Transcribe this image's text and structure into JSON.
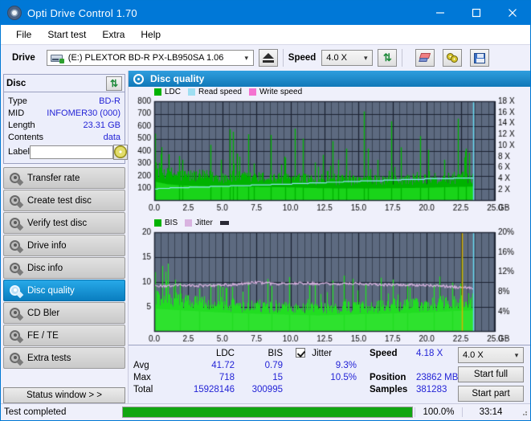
{
  "window": {
    "title": "Opti Drive Control 1.70",
    "minimize": "–",
    "maximize": "☐",
    "close": "✕"
  },
  "menu": [
    "File",
    "Start test",
    "Extra",
    "Help"
  ],
  "toolbar": {
    "drive_label": "Drive",
    "drive_value": "(E:)   PLEXTOR BD-R  PX-LB950SA 1.06",
    "speed_label": "Speed",
    "speed_value": "4.0 X"
  },
  "disc": {
    "title": "Disc",
    "rows": [
      {
        "key": "Type",
        "value": "BD-R"
      },
      {
        "key": "MID",
        "value": "INFOMER30 (000)"
      },
      {
        "key": "Length",
        "value": "23.31 GB"
      },
      {
        "key": "Contents",
        "value": "data"
      }
    ],
    "label_key": "Label",
    "label_value": ""
  },
  "nav": {
    "items": [
      {
        "label": "Transfer rate",
        "selected": false
      },
      {
        "label": "Create test disc",
        "selected": false
      },
      {
        "label": "Verify test disc",
        "selected": false
      },
      {
        "label": "Drive info",
        "selected": false
      },
      {
        "label": "Disc info",
        "selected": false
      },
      {
        "label": "Disc quality",
        "selected": true
      },
      {
        "label": "CD Bler",
        "selected": false
      },
      {
        "label": "FE / TE",
        "selected": false
      },
      {
        "label": "Extra tests",
        "selected": false
      }
    ],
    "status_window": "Status window > >"
  },
  "panel": {
    "title": "Disc quality"
  },
  "stats": {
    "col_ldc": "LDC",
    "col_bis": "BIS",
    "jitter_label": "Jitter",
    "jitter_checked": true,
    "rows": [
      {
        "name": "Avg",
        "ldc": "41.72",
        "bis": "0.79",
        "jitter": "9.3%"
      },
      {
        "name": "Max",
        "ldc": "718",
        "bis": "15",
        "jitter": "10.5%"
      },
      {
        "name": "Total",
        "ldc": "15928146",
        "bis": "300995",
        "jitter": ""
      }
    ],
    "speed_label": "Speed",
    "speed_value": "4.18 X",
    "position_label": "Position",
    "position_value": "23862 MB",
    "samples_label": "Samples",
    "samples_value": "381283",
    "speed_select": "4.0 X",
    "start_full": "Start full",
    "start_part": "Start part"
  },
  "statusbar": {
    "text": "Test completed",
    "percent": "100.0%",
    "progress": 100,
    "time": "33:14"
  },
  "colors": {
    "accent": "#0078d7",
    "value_blue": "#2323d6",
    "ldc_green": "#00b200",
    "bar_green": "#22dd22",
    "read_speed": "#66d9f0",
    "write_speed": "#f060d0",
    "jitter_pink": "#d9b3e0",
    "plot_bg": "#5d6a80",
    "progress_green": "#11a611"
  },
  "chart_data": [
    {
      "type": "area",
      "name": "ldc-chart",
      "title": "",
      "legend": [
        {
          "label": "LDC",
          "color": "#00b200"
        },
        {
          "label": "Read speed",
          "color": "#9fdff2"
        },
        {
          "label": "Write speed",
          "color": "#f472d0"
        }
      ],
      "legend_position": "top-left",
      "xlabel": "GB",
      "ylabel": "",
      "y2label": "X",
      "xlim": [
        0.0,
        25.0
      ],
      "xticks": [
        0.0,
        2.5,
        5.0,
        7.5,
        10.0,
        12.5,
        15.0,
        17.5,
        20.0,
        22.5,
        25.0
      ],
      "xtick_labels": [
        "0.0",
        "2.5",
        "5.0",
        "7.5",
        "10.0",
        "12.5",
        "15.0",
        "17.5",
        "20.0",
        "22.5",
        "25.0"
      ],
      "ylim": [
        0,
        800
      ],
      "yticks": [
        100,
        200,
        300,
        400,
        500,
        600,
        700,
        800
      ],
      "ytick_labels": [
        "100",
        "200",
        "300",
        "400",
        "500",
        "600",
        "700",
        "800"
      ],
      "y2lim": [
        0,
        18
      ],
      "y2ticks": [
        2,
        4,
        6,
        8,
        10,
        12,
        14,
        16,
        18
      ],
      "y2tick_labels": [
        "2 X",
        "4 X",
        "6 X",
        "8 X",
        "10 X",
        "12 X",
        "14 X",
        "16 X",
        "18 X"
      ],
      "grid": true,
      "data_end_gb": 23.4,
      "series": [
        {
          "name": "LDC",
          "color": "#00b200",
          "baseline": [
            {
              "x": 0.0,
              "y": 250
            },
            {
              "x": 1.0,
              "y": 215
            },
            {
              "x": 2.0,
              "y": 200
            },
            {
              "x": 4.0,
              "y": 190
            },
            {
              "x": 6.0,
              "y": 185
            },
            {
              "x": 8.0,
              "y": 180
            },
            {
              "x": 10.0,
              "y": 175
            },
            {
              "x": 12.0,
              "y": 165
            },
            {
              "x": 14.0,
              "y": 160
            },
            {
              "x": 16.0,
              "y": 160
            },
            {
              "x": 18.0,
              "y": 165
            },
            {
              "x": 20.0,
              "y": 170
            },
            {
              "x": 22.0,
              "y": 180
            },
            {
              "x": 23.4,
              "y": 185
            }
          ],
          "spikes": [
            {
              "x": 0.05,
              "y": 540
            },
            {
              "x": 1.8,
              "y": 360
            },
            {
              "x": 2.05,
              "y": 330
            },
            {
              "x": 4.1,
              "y": 450
            },
            {
              "x": 4.9,
              "y": 330
            },
            {
              "x": 5.55,
              "y": 575
            },
            {
              "x": 5.75,
              "y": 555
            },
            {
              "x": 6.05,
              "y": 380
            },
            {
              "x": 6.9,
              "y": 535
            },
            {
              "x": 7.3,
              "y": 300
            },
            {
              "x": 8.55,
              "y": 530
            },
            {
              "x": 9.6,
              "y": 345
            },
            {
              "x": 10.3,
              "y": 580
            },
            {
              "x": 10.9,
              "y": 500
            },
            {
              "x": 12.4,
              "y": 370
            },
            {
              "x": 13.1,
              "y": 480
            },
            {
              "x": 13.5,
              "y": 330
            },
            {
              "x": 14.1,
              "y": 420
            },
            {
              "x": 15.4,
              "y": 718
            },
            {
              "x": 15.7,
              "y": 420
            },
            {
              "x": 17.4,
              "y": 640
            },
            {
              "x": 18.1,
              "y": 430
            },
            {
              "x": 19.5,
              "y": 520
            },
            {
              "x": 20.1,
              "y": 410
            },
            {
              "x": 21.3,
              "y": 330
            },
            {
              "x": 22.3,
              "y": 660
            },
            {
              "x": 22.9,
              "y": 420
            }
          ]
        },
        {
          "name": "Read speed",
          "color": "#8fe2f5",
          "points": [
            {
              "x": 0.0,
              "y": 2.15
            },
            {
              "x": 1.0,
              "y": 2.3
            },
            {
              "x": 2.0,
              "y": 2.4
            },
            {
              "x": 3.5,
              "y": 2.5
            },
            {
              "x": 5.0,
              "y": 2.65
            },
            {
              "x": 6.5,
              "y": 2.75
            },
            {
              "x": 8.0,
              "y": 2.9
            },
            {
              "x": 9.5,
              "y": 3.0
            },
            {
              "x": 11.0,
              "y": 3.15
            },
            {
              "x": 12.5,
              "y": 3.3
            },
            {
              "x": 14.0,
              "y": 3.45
            },
            {
              "x": 15.5,
              "y": 3.6
            },
            {
              "x": 17.0,
              "y": 3.7
            },
            {
              "x": 18.5,
              "y": 3.85
            },
            {
              "x": 20.0,
              "y": 3.95
            },
            {
              "x": 21.5,
              "y": 4.05
            },
            {
              "x": 23.4,
              "y": 4.1
            }
          ]
        }
      ],
      "markers": [
        {
          "type": "vline",
          "x": 23.4,
          "color": "#66d9f0"
        }
      ]
    },
    {
      "type": "area",
      "name": "bis-jitter-chart",
      "title": "",
      "legend": [
        {
          "label": "BIS",
          "color": "#00b200"
        },
        {
          "label": "Jitter",
          "color": "#d9b3e0"
        },
        {
          "label": "",
          "color": "#2a2a35"
        }
      ],
      "legend_position": "top-left",
      "xlabel": "GB",
      "ylabel": "",
      "y2label": "%",
      "xlim": [
        0.0,
        25.0
      ],
      "xticks": [
        0.0,
        2.5,
        5.0,
        7.5,
        10.0,
        12.5,
        15.0,
        17.5,
        20.0,
        22.5,
        25.0
      ],
      "xtick_labels": [
        "0.0",
        "2.5",
        "5.0",
        "7.5",
        "10.0",
        "12.5",
        "15.0",
        "17.5",
        "20.0",
        "22.5",
        "25.0"
      ],
      "ylim": [
        0,
        20
      ],
      "yticks": [
        5,
        10,
        15,
        20
      ],
      "ytick_labels": [
        "5",
        "10",
        "15",
        "20"
      ],
      "y2lim": [
        0,
        20
      ],
      "y2ticks": [
        4,
        8,
        12,
        16,
        20
      ],
      "y2tick_labels": [
        "4%",
        "8%",
        "12%",
        "16%",
        "20%"
      ],
      "grid": true,
      "data_end_gb": 23.4,
      "series": [
        {
          "name": "BIS",
          "color": "#22dd22",
          "baseline": [
            {
              "x": 0.0,
              "y": 6.5
            },
            {
              "x": 2.0,
              "y": 6.0
            },
            {
              "x": 4.0,
              "y": 5.6
            },
            {
              "x": 6.0,
              "y": 5.2
            },
            {
              "x": 8.0,
              "y": 5.0
            },
            {
              "x": 10.0,
              "y": 4.8
            },
            {
              "x": 12.0,
              "y": 4.6
            },
            {
              "x": 14.0,
              "y": 4.8
            },
            {
              "x": 16.0,
              "y": 5.0
            },
            {
              "x": 18.0,
              "y": 5.2
            },
            {
              "x": 20.0,
              "y": 5.4
            },
            {
              "x": 22.0,
              "y": 5.8
            },
            {
              "x": 23.4,
              "y": 6.0
            }
          ],
          "spikes": [
            {
              "x": 0.05,
              "y": 12.0
            },
            {
              "x": 1.9,
              "y": 9.8
            },
            {
              "x": 3.3,
              "y": 8.7
            },
            {
              "x": 5.7,
              "y": 9.0
            },
            {
              "x": 6.9,
              "y": 10.0
            },
            {
              "x": 8.6,
              "y": 9.2
            },
            {
              "x": 9.9,
              "y": 11.0
            },
            {
              "x": 11.4,
              "y": 9.3
            },
            {
              "x": 13.9,
              "y": 11.3
            },
            {
              "x": 15.5,
              "y": 9.5
            },
            {
              "x": 17.5,
              "y": 10.5
            },
            {
              "x": 18.6,
              "y": 9.6
            },
            {
              "x": 20.5,
              "y": 9.4
            },
            {
              "x": 21.9,
              "y": 9.9
            },
            {
              "x": 22.6,
              "y": 15.0
            }
          ]
        },
        {
          "name": "Jitter",
          "color": "#d9b3e0",
          "avg": 9.3,
          "max": 10.5,
          "points": [
            {
              "x": 0.0,
              "y": 9.2
            },
            {
              "x": 2.0,
              "y": 9.3
            },
            {
              "x": 4.0,
              "y": 9.3
            },
            {
              "x": 6.0,
              "y": 9.5
            },
            {
              "x": 7.5,
              "y": 9.9
            },
            {
              "x": 9.0,
              "y": 9.6
            },
            {
              "x": 11.0,
              "y": 9.8
            },
            {
              "x": 13.0,
              "y": 9.6
            },
            {
              "x": 15.0,
              "y": 9.7
            },
            {
              "x": 17.0,
              "y": 9.4
            },
            {
              "x": 19.0,
              "y": 9.4
            },
            {
              "x": 21.0,
              "y": 9.2
            },
            {
              "x": 22.5,
              "y": 8.9
            },
            {
              "x": 23.4,
              "y": 8.8
            }
          ]
        }
      ],
      "markers": [
        {
          "type": "vline",
          "x": 23.4,
          "color": "#66d9f0"
        },
        {
          "type": "vline",
          "x": 22.6,
          "color": "#d8b400"
        }
      ]
    }
  ]
}
